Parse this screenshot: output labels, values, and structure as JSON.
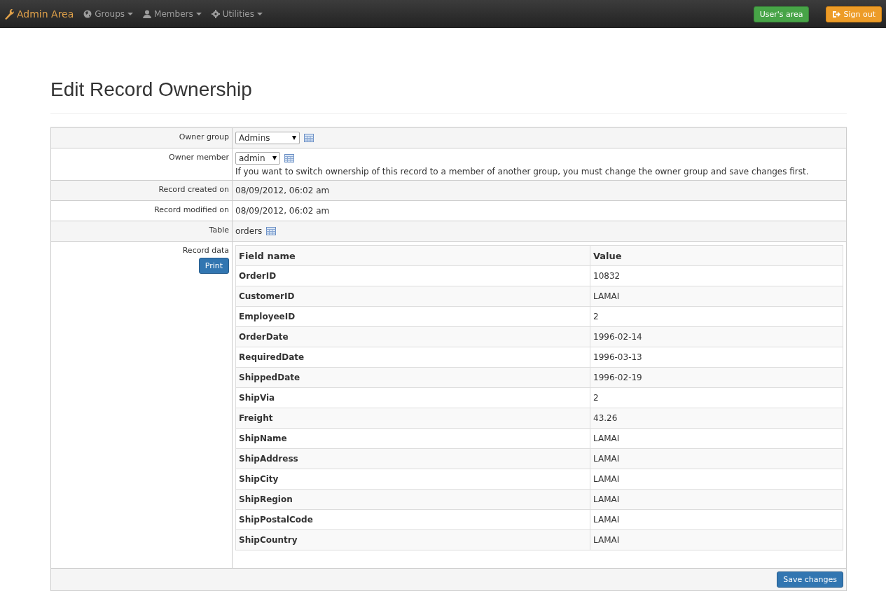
{
  "navbar": {
    "brand": "Admin Area",
    "menus": [
      {
        "label": "Groups"
      },
      {
        "label": "Members"
      },
      {
        "label": "Utilities"
      }
    ],
    "users_area_button": "User's area",
    "sign_out_button": "Sign out"
  },
  "page_title": "Edit Record Ownership",
  "form": {
    "owner_group": {
      "label": "Owner group",
      "value": "Admins"
    },
    "owner_member": {
      "label": "Owner member",
      "value": "admin",
      "hint": "If you want to switch ownership of this record to a member of another group, you must change the owner group and save changes first."
    },
    "created": {
      "label": "Record created on",
      "value": "08/09/2012, 06:02 am"
    },
    "modified": {
      "label": "Record modified on",
      "value": "08/09/2012, 06:02 am"
    },
    "table": {
      "label": "Table",
      "value": "orders"
    },
    "record_data": {
      "label": "Record data",
      "print_button": "Print",
      "columns": [
        "Field name",
        "Value"
      ],
      "rows": [
        {
          "field": "OrderID",
          "value": "10832"
        },
        {
          "field": "CustomerID",
          "value": "LAMAI"
        },
        {
          "field": "EmployeeID",
          "value": "2"
        },
        {
          "field": "OrderDate",
          "value": "1996-02-14"
        },
        {
          "field": "RequiredDate",
          "value": "1996-03-13"
        },
        {
          "field": "ShippedDate",
          "value": "1996-02-19"
        },
        {
          "field": "ShipVia",
          "value": "2"
        },
        {
          "field": "Freight",
          "value": "43.26"
        },
        {
          "field": "ShipName",
          "value": "LAMAI"
        },
        {
          "field": "ShipAddress",
          "value": "LAMAI"
        },
        {
          "field": "ShipCity",
          "value": "LAMAI"
        },
        {
          "field": "ShipRegion",
          "value": "LAMAI"
        },
        {
          "field": "ShipPostalCode",
          "value": "LAMAI"
        },
        {
          "field": "ShipCountry",
          "value": "LAMAI"
        }
      ]
    },
    "save_button": "Save changes"
  }
}
